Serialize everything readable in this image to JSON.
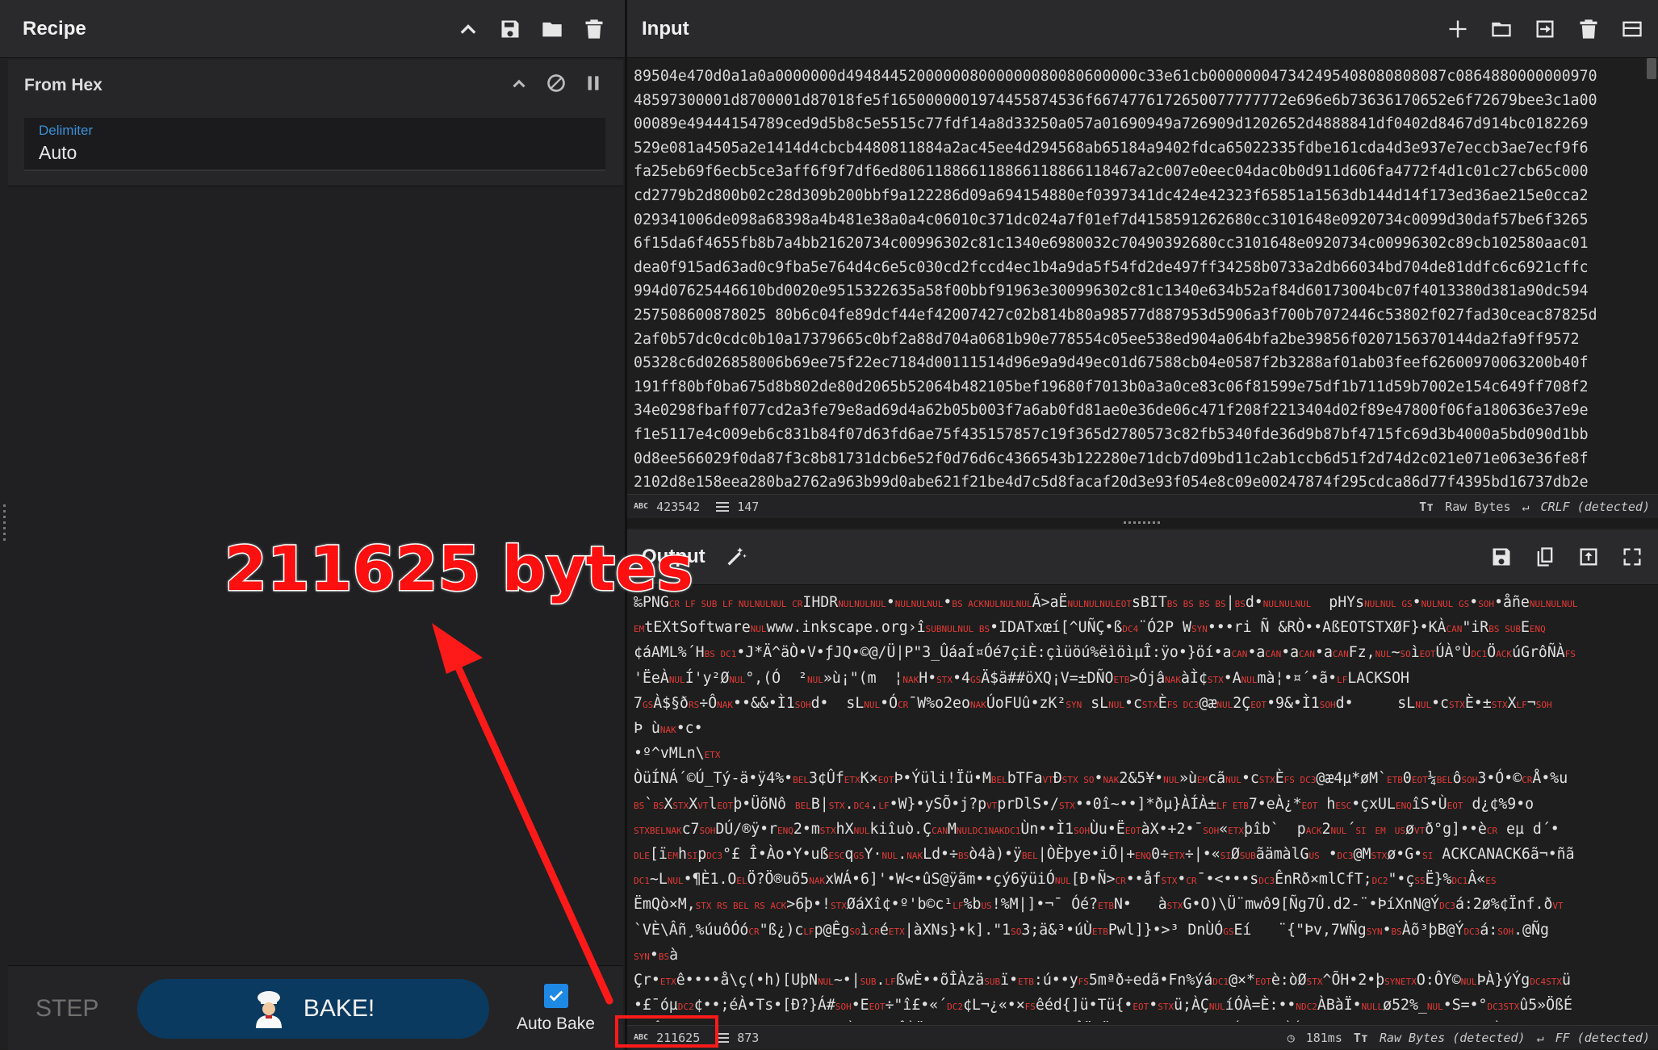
{
  "recipe": {
    "title": "Recipe",
    "operation": {
      "name": "From Hex",
      "delimiter_label": "Delimiter",
      "delimiter_value": "Auto"
    },
    "step_label": "STEP",
    "bake_label": "BAKE!",
    "auto_bake_label": "Auto Bake",
    "auto_bake_checked": true
  },
  "input": {
    "title": "Input",
    "lines": [
      "89504e470d0a1a0a0000000d494844520000008000000080080600000c33e61cb000000047342495408080808087c0864880000000970",
      "48597300001d8700001d87018fe5f1650000001974455874536f6674776172650077777772e696e6b73636170652e6f72679bee3c1a00",
      "00089e49444154789ced9d5b8c5e5515c77fdf14a8d33250a057a01690949a726909d1202652d4888841df0402d8467d914bc0182269",
      "529e081a4505a2e1414d4cbcb4480811884a2ac45ee4d294568ab65184a9402fdca65022335fdbe161cda4d3e937e7eccb3ae7ecf9f6",
      "fa25eb69f6ecb5ce3aff6f9f7df6ed806118866118866118866118467a2c007e0eec04dac0b0d911d606fa4772f4d1c01c27cb65c000",
      "cd2779b2d800b02c28d309b200bbf9a122286d09a694154880ef0397341dc424e42323f65851a1563db144d14f173ed36ae215e0cca2",
      "029341006de098a68398a4b481e38a0a4c06010c371dc024a7f01ef7d4158591262680cc3101648e0920734c0099d30daf57be6f3265",
      "6f15da6f4655fb8b7a4bb21620734c00996302c81c1340e6980032c70490392680cc3101648e0920734c00996302c89cb102580aac01",
      "dea0f915ad63ad0c9fba5e764d4c6e5c030cd2fccd4ec1b4a9da5f54fd2de497ff34258b0733a2db66034bd704de81ddfc6c6921cffc",
      "994d07625446610bd0020e9515322635a58f00bbf91963e300996302c81c1340e634b52af84d60173004bc07f4013380d381a90dc594",
      "257508600878025 80b6c04fe89dcf44ef42007427c02b814b80a98577d887953d5906a3f700b7072446c53802f027fad30ceac87825d",
      "2af0b57dc0cdc0b10a17379665c0bf2a88d704a0681b90e778554c05ee538ed904a064bfa2be39856f0207156370144da2fa9ff9572",
      "05328c6d026858006b69ee75f22ec7184d00111514d96e9a9d49ec01d67588cb04e0587f2b3288af01ab03feef62600970063200b40f",
      "191ff80bf0ba675d8b802de80d2065b52064b482105bef19680f7013b0a3a0ce83c06f81599e75df1b711d59b7002e154c649ff708f2",
      "34e0298fbaff077cd2a3fe79e8ad69d4a62b05b003f7a6ab0fd81ae0e36de06c471f208f2213404d02f89e47800f06fa180636e37e9e",
      "f1e5117e4c009eb6c831b84f07d63fd6ae75f435157857c19f365d2780573c82fb5340fde36d9b87bf4715fc69d3b4000a5bd090d1bb",
      "0d8ee566029f0da87f3c8b81731dcb6e52f0d76d6c4366543b122280e71dcb7d09bd11c2ab1ccb6d51f2d74d2c021e071e063e36fe8f",
      "2102d8e158eea280ba2762a963b99d0abe621f21be4d7c5d8facaf20d3e93f054e8c09e00247874f295cdca86d77f4395bd16737db2e"
    ],
    "status": {
      "length": "423542",
      "lines": "147",
      "encoding": "Raw Bytes",
      "eol": "CRLF (detected)"
    }
  },
  "output": {
    "title": "Output",
    "status": {
      "length": "211625",
      "lines": "873",
      "time": "181ms",
      "encoding": "Raw Bytes (detected)",
      "eol": "FF (detected)"
    }
  },
  "annotation": {
    "label": "211625 bytes"
  }
}
